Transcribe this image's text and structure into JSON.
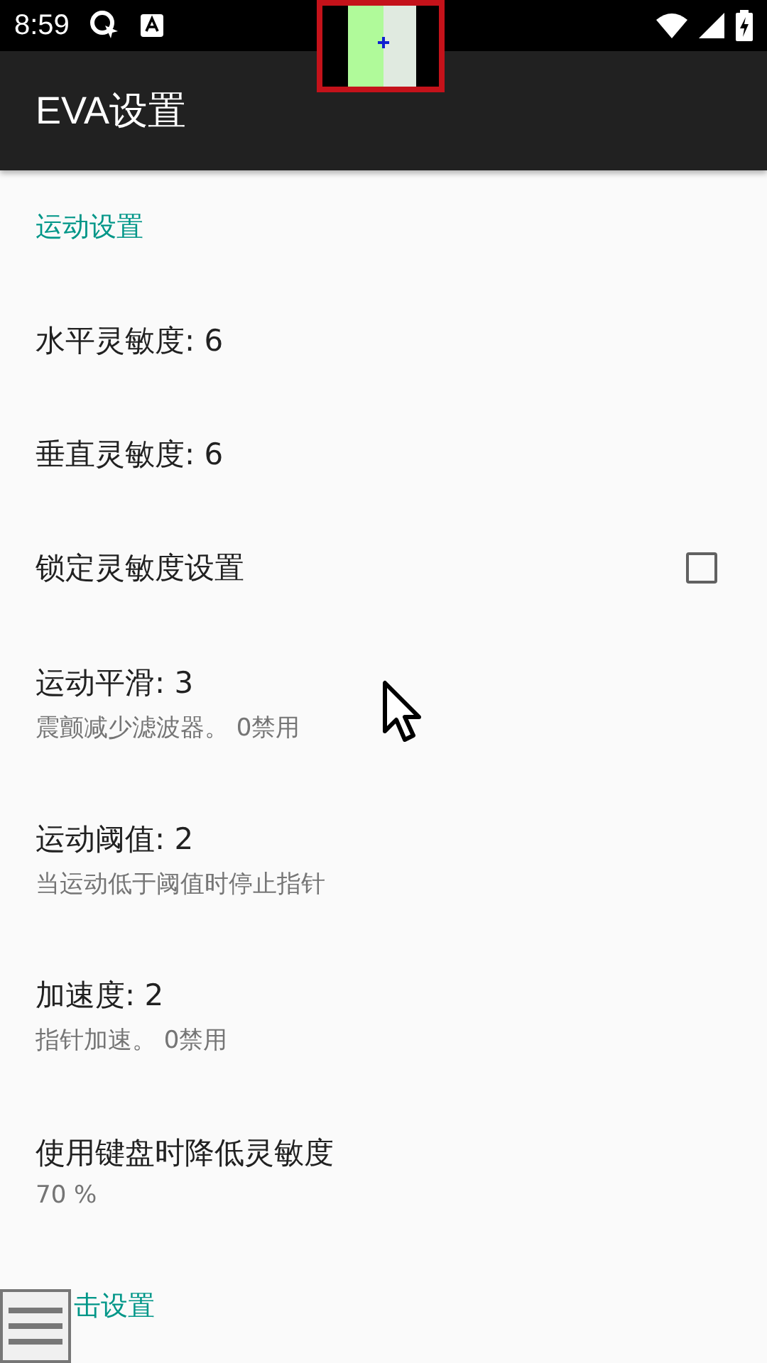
{
  "status_bar": {
    "time": "8:59"
  },
  "app_bar": {
    "title": "EVA设置"
  },
  "sections": [
    {
      "title": "运动设置",
      "items": [
        {
          "kind": "setting",
          "title": "水平灵敏度: 6"
        },
        {
          "kind": "setting",
          "title": "垂直灵敏度: 6"
        },
        {
          "kind": "checkbox",
          "title": "锁定灵敏度设置",
          "checked": false
        },
        {
          "kind": "setting",
          "title": "运动平滑: 3",
          "summary": "震颤减少滤波器。 0禁用"
        },
        {
          "kind": "setting",
          "title": "运动阈值: 2",
          "summary": "当运动低于阈值时停止指针"
        },
        {
          "kind": "setting",
          "title": "加速度: 2",
          "summary": "指针加速。 0禁用"
        },
        {
          "kind": "setting",
          "title": "使用键盘时降低灵敏度",
          "summary": "70 %"
        }
      ]
    },
    {
      "title": "击设置"
    }
  ]
}
